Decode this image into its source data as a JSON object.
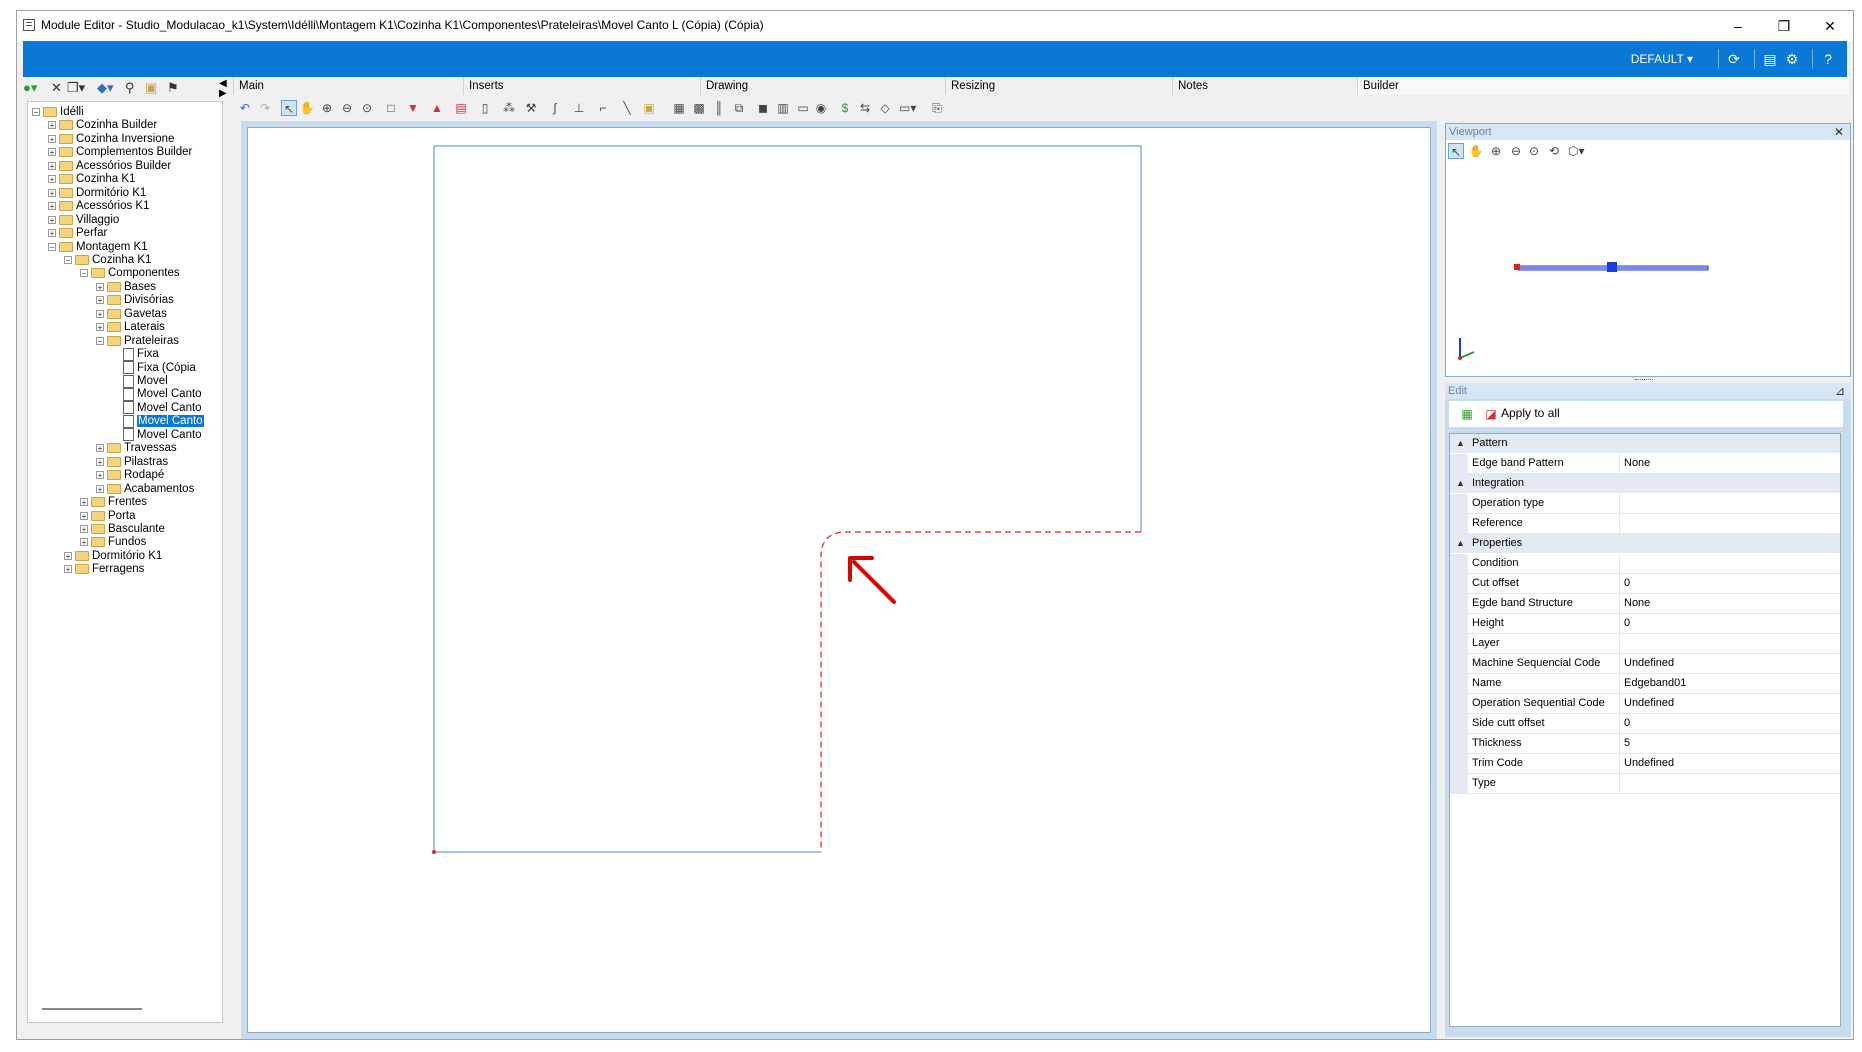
{
  "window": {
    "title": "Module Editor - Studio_Modulacao_k1\\System\\Idélli\\Montagem K1\\Cozinha K1\\Componentes\\Prateleiras\\Movel Canto L (Cópia) (Cópia)",
    "minimize": "–",
    "maximize": "❐",
    "close": "✕"
  },
  "topbar": {
    "profile_label": "DEFAULT ▾",
    "accent": "#0a78d7"
  },
  "tabs": [
    "Main",
    "Inserts",
    "Drawing",
    "Resizing",
    "Notes",
    "Builder"
  ],
  "tree": [
    {
      "label": "Idélli",
      "level": 0,
      "type": "folder",
      "exp": "−"
    },
    {
      "label": "Cozinha Builder",
      "level": 1,
      "type": "folder",
      "exp": "+"
    },
    {
      "label": "Cozinha Inversione",
      "level": 1,
      "type": "folder",
      "exp": "+"
    },
    {
      "label": "Complementos Builder",
      "level": 1,
      "type": "folder",
      "exp": "+"
    },
    {
      "label": "Acessórios Builder",
      "level": 1,
      "type": "folder",
      "exp": "+"
    },
    {
      "label": "Cozinha K1",
      "level": 1,
      "type": "folder",
      "exp": "+"
    },
    {
      "label": "Dormitório K1",
      "level": 1,
      "type": "folder",
      "exp": "+"
    },
    {
      "label": "Acessórios K1",
      "level": 1,
      "type": "folder",
      "exp": "+"
    },
    {
      "label": "Villaggio",
      "level": 1,
      "type": "folder",
      "exp": "+"
    },
    {
      "label": "Perfar",
      "level": 1,
      "type": "folder",
      "exp": "+"
    },
    {
      "label": "Montagem K1",
      "level": 1,
      "type": "folder",
      "exp": "−"
    },
    {
      "label": "Cozinha K1",
      "level": 2,
      "type": "folder",
      "exp": "−"
    },
    {
      "label": "Componentes",
      "level": 3,
      "type": "folder",
      "exp": "−"
    },
    {
      "label": "Bases",
      "level": 4,
      "type": "folder",
      "exp": "+"
    },
    {
      "label": "Divisórias",
      "level": 4,
      "type": "folder",
      "exp": "+"
    },
    {
      "label": "Gavetas",
      "level": 4,
      "type": "folder",
      "exp": "+"
    },
    {
      "label": "Laterais",
      "level": 4,
      "type": "folder",
      "exp": "+"
    },
    {
      "label": "Prateleiras",
      "level": 4,
      "type": "folder",
      "exp": "−"
    },
    {
      "label": "Fixa",
      "level": 5,
      "type": "doc",
      "exp": ""
    },
    {
      "label": "Fixa (Cópia",
      "level": 5,
      "type": "doc",
      "exp": ""
    },
    {
      "label": "Movel",
      "level": 5,
      "type": "doc",
      "exp": ""
    },
    {
      "label": "Movel Canto",
      "level": 5,
      "type": "doc",
      "exp": ""
    },
    {
      "label": "Movel Canto",
      "level": 5,
      "type": "doc",
      "exp": ""
    },
    {
      "label": "Movel Canto",
      "level": 5,
      "type": "doc",
      "exp": "",
      "selected": true
    },
    {
      "label": "Movel Canto",
      "level": 5,
      "type": "doc",
      "exp": ""
    },
    {
      "label": "Travessas",
      "level": 4,
      "type": "folder",
      "exp": "+"
    },
    {
      "label": "Pilastras",
      "level": 4,
      "type": "folder",
      "exp": "+"
    },
    {
      "label": "Rodapé",
      "level": 4,
      "type": "folder",
      "exp": "+"
    },
    {
      "label": "Acabamentos",
      "level": 4,
      "type": "folder",
      "exp": "+"
    },
    {
      "label": "Frentes",
      "level": 3,
      "type": "folder",
      "exp": "+"
    },
    {
      "label": "Porta",
      "level": 3,
      "type": "folder",
      "exp": "+"
    },
    {
      "label": "Basculante",
      "level": 3,
      "type": "folder",
      "exp": "+"
    },
    {
      "label": "Fundos",
      "level": 3,
      "type": "folder",
      "exp": "+"
    },
    {
      "label": "Dormitório K1",
      "level": 2,
      "type": "folder",
      "exp": "+"
    },
    {
      "label": "Ferragens",
      "level": 2,
      "type": "folder",
      "exp": "+"
    }
  ],
  "viewport": {
    "title": "Viewport",
    "close": "✕"
  },
  "edit": {
    "title": "Edit",
    "pin": "⊿",
    "apply_all_label": "Apply to all",
    "categories": [
      {
        "name": "Pattern",
        "rows": [
          {
            "name": "Edge band Pattern",
            "value": "None"
          }
        ]
      },
      {
        "name": "Integration",
        "rows": [
          {
            "name": "Operation type",
            "value": ""
          },
          {
            "name": "Reference",
            "value": ""
          }
        ]
      },
      {
        "name": "Properties",
        "rows": [
          {
            "name": "Condition",
            "value": ""
          },
          {
            "name": "Cut offset",
            "value": "0"
          },
          {
            "name": "Egde band Structure",
            "value": "None"
          },
          {
            "name": "Height",
            "value": "0"
          },
          {
            "name": "Layer",
            "value": ""
          },
          {
            "name": "Machine Sequencial Code",
            "value": "Undefined"
          },
          {
            "name": "Name",
            "value": "Edgeband01"
          },
          {
            "name": "Operation Sequential Code",
            "value": "Undefined"
          },
          {
            "name": "Side cutt offset",
            "value": "0"
          },
          {
            "name": "Thickness",
            "value": "5"
          },
          {
            "name": "Trim Code",
            "value": "Undefined"
          },
          {
            "name": "Type",
            "value": ""
          }
        ]
      }
    ]
  },
  "colors": {
    "shape_outline": "#4a8ac8",
    "edgeband": "#e02020",
    "arrow": "#e00000",
    "viewport_marker": "#1a3be0"
  }
}
